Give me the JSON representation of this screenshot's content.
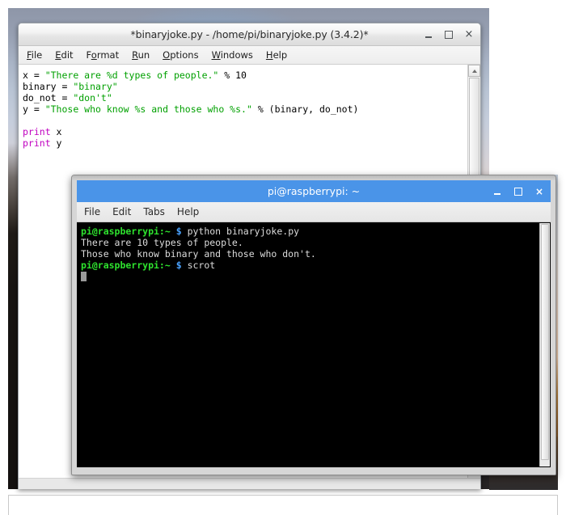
{
  "desktop": {
    "wallpaper_name": "road-at-dusk-photo"
  },
  "idle_window": {
    "title": "*binaryjoke.py - /home/pi/binaryjoke.py (3.4.2)*",
    "menu": [
      {
        "pre": "",
        "accel": "F",
        "post": "ile"
      },
      {
        "pre": "",
        "accel": "E",
        "post": "dit"
      },
      {
        "pre": "F",
        "accel": "o",
        "post": "rmat"
      },
      {
        "pre": "",
        "accel": "R",
        "post": "un"
      },
      {
        "pre": "",
        "accel": "O",
        "post": "ptions"
      },
      {
        "pre": "",
        "accel": "W",
        "post": "indows"
      },
      {
        "pre": "",
        "accel": "H",
        "post": "elp"
      }
    ],
    "window_buttons": {
      "minimize": "minimize-icon",
      "maximize": "maximize-icon",
      "close": "×"
    },
    "code_lines": [
      [
        {
          "t": "x = ",
          "c": "plain"
        },
        {
          "t": "\"There are %d types of people.\"",
          "c": "str"
        },
        {
          "t": " % 10",
          "c": "plain"
        }
      ],
      [
        {
          "t": "binary = ",
          "c": "plain"
        },
        {
          "t": "\"binary\"",
          "c": "str"
        }
      ],
      [
        {
          "t": "do_not = ",
          "c": "plain"
        },
        {
          "t": "\"don't\"",
          "c": "str"
        }
      ],
      [
        {
          "t": "y = ",
          "c": "plain"
        },
        {
          "t": "\"Those who know %s and those who %s.\"",
          "c": "str"
        },
        {
          "t": " % (binary, do_not)",
          "c": "plain"
        }
      ],
      [],
      [
        {
          "t": "print",
          "c": "kw"
        },
        {
          "t": " x",
          "c": "plain"
        }
      ],
      [
        {
          "t": "print",
          "c": "kw"
        },
        {
          "t": " y",
          "c": "plain"
        }
      ]
    ]
  },
  "terminal_window": {
    "title": "pi@raspberrypi: ~",
    "menu": [
      "File",
      "Edit",
      "Tabs",
      "Help"
    ],
    "window_buttons": {
      "minimize": "minimize-icon",
      "maximize": "maximize-icon",
      "close": "×"
    },
    "lines": [
      {
        "prompt": "pi@raspberrypi:~",
        "dollar": "$",
        "command": " python binaryjoke.py"
      },
      {
        "output": "There are 10 types of people."
      },
      {
        "output": "Those who know binary and those who don't."
      },
      {
        "prompt": "pi@raspberrypi:~",
        "dollar": "$",
        "command": " scrot"
      },
      {
        "cursor": true
      }
    ]
  },
  "colors": {
    "titlebar_blue": "#4a94e8",
    "prompt_green": "#2ee22e",
    "prompt_blue": "#4aa3ff",
    "string_green": "#00a000",
    "keyword_magenta": "#c000c0",
    "terminal_bg": "#000000"
  }
}
